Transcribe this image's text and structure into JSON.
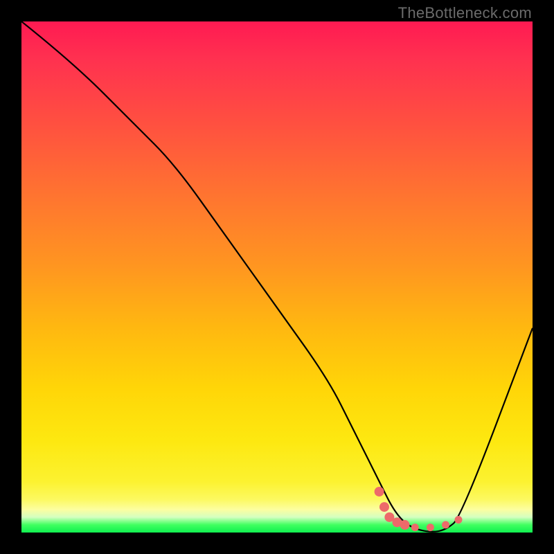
{
  "watermark": "TheBottleneck.com",
  "chart_data": {
    "type": "line",
    "title": "",
    "xlabel": "",
    "ylabel": "",
    "xlim": [
      0,
      100
    ],
    "ylim": [
      0,
      100
    ],
    "series": [
      {
        "name": "curve",
        "x": [
          0,
          10,
          22,
          30,
          40,
          50,
          60,
          65,
          70,
          73,
          76,
          80,
          83,
          86,
          100
        ],
        "y": [
          100,
          92,
          80,
          72,
          58,
          44,
          30,
          20,
          10,
          4,
          1,
          0,
          0.5,
          3,
          40
        ]
      }
    ],
    "markers": [
      {
        "x": 70,
        "y": 8
      },
      {
        "x": 71,
        "y": 5
      },
      {
        "x": 72,
        "y": 3
      },
      {
        "x": 73.5,
        "y": 2
      },
      {
        "x": 75,
        "y": 1.5
      },
      {
        "x": 77,
        "y": 1
      },
      {
        "x": 80,
        "y": 1
      },
      {
        "x": 83,
        "y": 1.5
      },
      {
        "x": 85.5,
        "y": 2.5
      }
    ],
    "colors": {
      "curve": "#000000",
      "markers": "#ed6a6a",
      "top": "#ff1a52",
      "bottom": "#10f050"
    }
  }
}
